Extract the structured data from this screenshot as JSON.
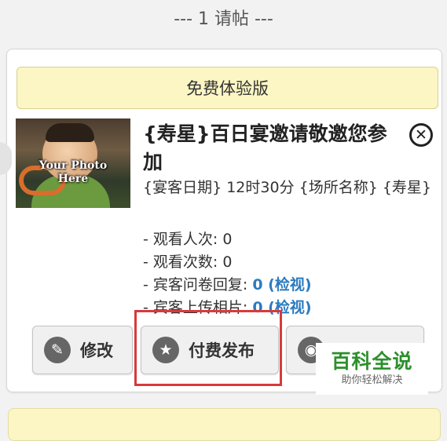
{
  "header": {
    "count_text": "---  1 请帖 ---"
  },
  "card": {
    "trial_banner": "免费体验版",
    "photo": {
      "watermark_line1": "Your Photo",
      "watermark_line2": "Here"
    },
    "title": "{寿星}百日宴邀请敬邀您参加",
    "subtitle": "{宴客日期} 12时30分 {场所名称} {寿星}",
    "stats": [
      {
        "label": "- 观看人次: ",
        "value": "0"
      },
      {
        "label": "- 观看次数: ",
        "value": "0"
      },
      {
        "label": "- 宾客问卷回复: ",
        "value": "0 (检视)"
      },
      {
        "label": "- 宾客上传相片: ",
        "value": "0 (检视)"
      }
    ],
    "buttons": {
      "edit": "修改",
      "publish": "付费发布"
    }
  },
  "watermark_logo": {
    "main": "百科全说",
    "sub": "助你轻松解决"
  },
  "icons": {
    "edit": "pencil-icon",
    "publish": "star-icon",
    "view": "eye-icon",
    "close": "close-circle-icon"
  },
  "colors": {
    "banner_bg": "#fbf6c4",
    "link": "#2b7bc0",
    "highlight": "#d83a3a",
    "logo_green": "#2c8f2c"
  }
}
